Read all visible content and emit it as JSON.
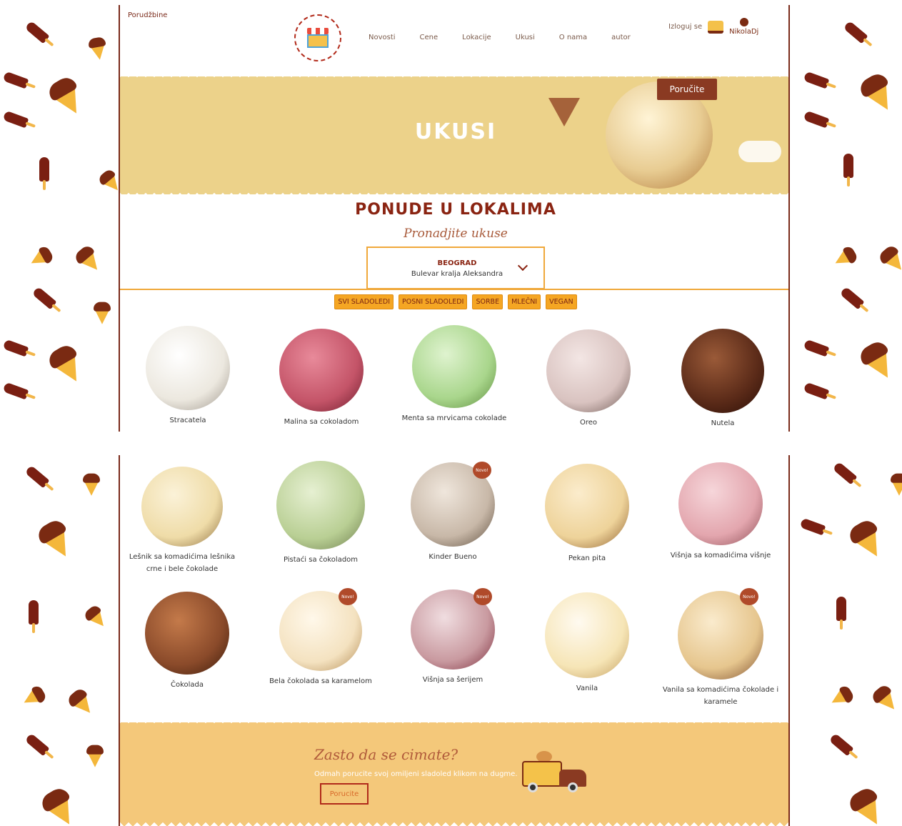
{
  "header": {
    "orders_link": "Porudžbine",
    "menu": [
      "Novosti",
      "Cene",
      "Lokacije",
      "Ukusi",
      "O nama",
      "autor"
    ],
    "logout": "Izloguj se",
    "username": "NikolaDj"
  },
  "hero": {
    "title": "UKUSI",
    "order_button": "Poručite"
  },
  "section": {
    "title": "PONUDE U LOKALIMA",
    "subtitle": "Pronadjite ukuse",
    "location": {
      "city": "BEOGRAD",
      "address": "Bulevar kralja Aleksandra"
    },
    "filters": [
      "SVI SLADOLEDI",
      "POSNI SLADOLEDI",
      "SORBE",
      "MLEČNI",
      "VEGAN"
    ]
  },
  "flavors_row1": [
    {
      "name": "Stracatela",
      "color": "#ece8df"
    },
    {
      "name": "Malina sa cokoladom",
      "color": "#c45468"
    },
    {
      "name": "Menta sa mrvicama cokolade",
      "color": "#a9d68c"
    },
    {
      "name": "Oreo",
      "color": "#d9c3c0"
    },
    {
      "name": "Nutela",
      "color": "#5a2a18"
    }
  ],
  "flavors_row2": [
    {
      "name": "Lešnik sa komadićima lešnika crne i bele čokolade",
      "color": "#efdca8",
      "new": false
    },
    {
      "name": "Pistaći sa čokoladom",
      "color": "#b9cf94",
      "new": false
    },
    {
      "name": "Kinder Bueno",
      "color": "#c8b8a8",
      "new": true
    },
    {
      "name": "Pekan pita",
      "color": "#eed39a",
      "new": false
    },
    {
      "name": "Višnja sa komadićima višnje",
      "color": "#e3a6ae",
      "new": false
    }
  ],
  "flavors_row3": [
    {
      "name": "Čokolada",
      "color": "#8a4a2a",
      "new": false
    },
    {
      "name": "Bela čokolada sa karamelom",
      "color": "#f4e2c0",
      "new": true
    },
    {
      "name": "Višnja sa šerijem",
      "color": "#c99aa0",
      "new": true
    },
    {
      "name": "Vanila",
      "color": "#f6e5b6",
      "new": false
    },
    {
      "name": "Vanila sa komadićima čokolade i karamele",
      "color": "#e6c68e",
      "new": true
    }
  ],
  "badge_label": "Novo!",
  "cta": {
    "title": "Zasto da se cimate?",
    "text": "Odmah porucite svoj omiljeni sladoled klikom na dugme.",
    "button": "Porucite"
  }
}
